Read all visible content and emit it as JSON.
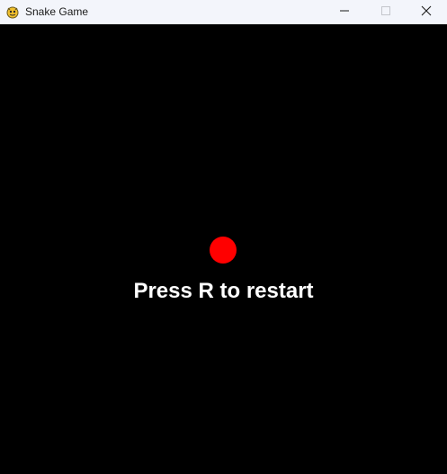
{
  "window": {
    "title": "Snake Game",
    "app_icon": "pygame-snake-icon",
    "controls": {
      "minimize_icon": "minimize-icon",
      "maximize_icon": "maximize-icon",
      "close_icon": "close-icon"
    }
  },
  "game": {
    "background_color": "#000000",
    "food_color": "#ff0000",
    "message": "Press R to restart",
    "message_color": "#ffffff"
  }
}
